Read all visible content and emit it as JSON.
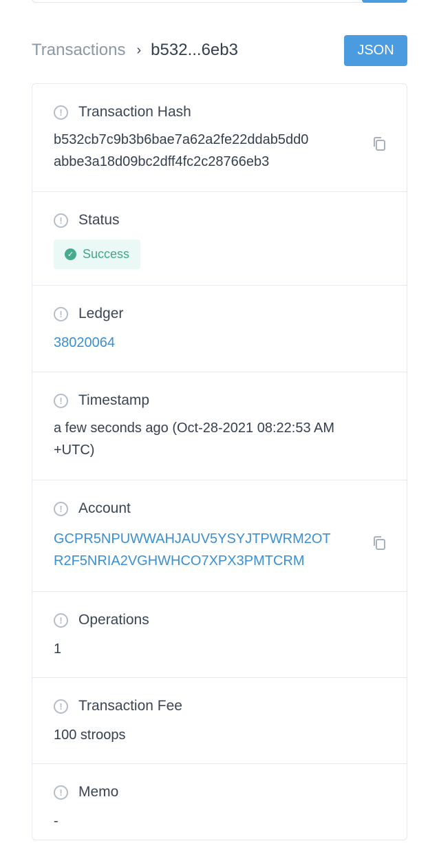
{
  "header": {
    "breadcrumb_root": "Transactions",
    "breadcrumb_separator": "›",
    "breadcrumb_current": "b532...6eb3",
    "json_button_label": "JSON"
  },
  "fields": {
    "hash": {
      "label": "Transaction Hash",
      "line1": "b532cb7c9b3b6bae7a62a2fe22ddab5dd0",
      "line2": "abbe3a18d09bc2dff4fc2c28766eb3"
    },
    "status": {
      "label": "Status",
      "value": "Success"
    },
    "ledger": {
      "label": "Ledger",
      "value": "38020064"
    },
    "timestamp": {
      "label": "Timestamp",
      "line1": "a few seconds ago (Oct-28-2021 08:22:53 AM",
      "line2": "+UTC)"
    },
    "account": {
      "label": "Account",
      "line1": "GCPR5NPUWWAHJAUV5YSYJTPWRM2OT",
      "line2": "R2F5NRIA2VGHWHCO7XPX3PMTCRM"
    },
    "operations": {
      "label": "Operations",
      "value": "1"
    },
    "fee": {
      "label": "Transaction Fee",
      "value": "100 stroops"
    },
    "memo": {
      "label": "Memo",
      "value": "-"
    }
  },
  "colors": {
    "accent": "#4a9be0",
    "link": "#3a8fd4",
    "success_bg": "#eaf9f5",
    "success_text": "#41a58a"
  },
  "icons": {
    "field_help": "question-circle-icon",
    "copy": "copy-icon",
    "status": "check-circle-icon"
  }
}
